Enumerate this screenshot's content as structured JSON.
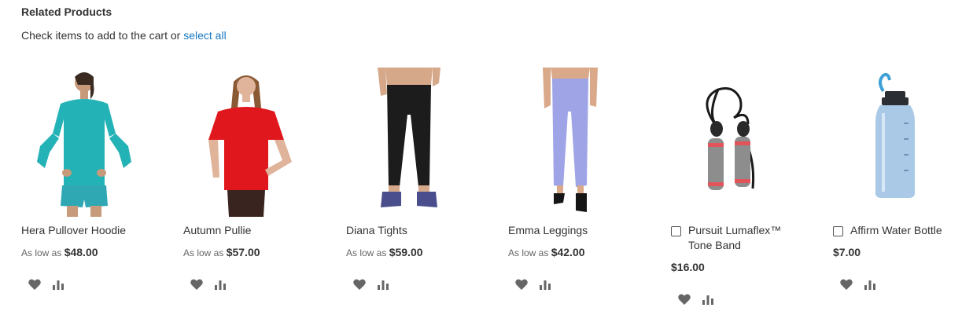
{
  "related": {
    "title": "Related Products",
    "check_text": "Check items to add to the cart or",
    "select_all": "select all",
    "products": [
      {
        "name": "Hera Pullover Hoodie",
        "price_prefix": "As low as",
        "price": "$48.00",
        "has_checkbox": false
      },
      {
        "name": "Autumn Pullie",
        "price_prefix": "As low as",
        "price": "$57.00",
        "has_checkbox": false
      },
      {
        "name": "Diana Tights",
        "price_prefix": "As low as",
        "price": "$59.00",
        "has_checkbox": false
      },
      {
        "name": "Emma Leggings",
        "price_prefix": "As low as",
        "price": "$42.00",
        "has_checkbox": false
      },
      {
        "name": "Pursuit Lumaflex™ Tone Band",
        "price_prefix": "",
        "price": "$16.00",
        "has_checkbox": true
      },
      {
        "name": "Affirm Water Bottle",
        "price_prefix": "",
        "price": "$7.00",
        "has_checkbox": true
      }
    ],
    "icons": {
      "wishlist": "heart-icon",
      "compare": "compare-icon"
    }
  },
  "colors": {
    "link": "#1979c3",
    "icon": "#666666"
  }
}
